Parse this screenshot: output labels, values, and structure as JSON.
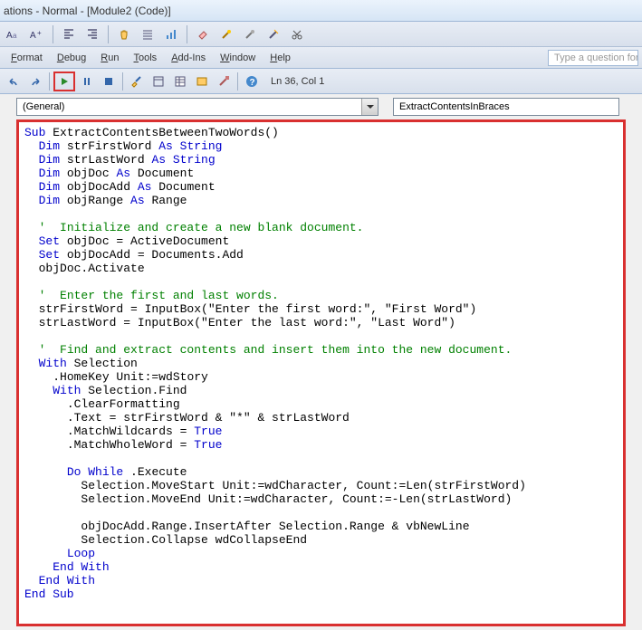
{
  "title": "ations - Normal - [Module2 (Code)]",
  "toolbar1_icons": [
    "aa-icon",
    "aplus-icon",
    "indent-left-icon",
    "indent-right-icon",
    "hand-icon",
    "lines-icon",
    "chart-icon",
    "eraser-icon",
    "wand-icon",
    "wand2-icon",
    "wand3-icon",
    "scissors-icon"
  ],
  "menu": {
    "format": "Format",
    "debug": "Debug",
    "run": "Run",
    "tools": "Tools",
    "addins": "Add-Ins",
    "window": "Window",
    "help": "Help"
  },
  "help_placeholder": "Type a question for h",
  "cursor_pos": "Ln 36, Col 1",
  "dropdown_left": "(General)",
  "dropdown_right": "ExtractContentsInBraces",
  "code": {
    "l1_a": "Sub",
    "l1_b": " ExtractContentsBetweenTwoWords()",
    "l2_a": "Dim",
    "l2_b": " strFirstWord ",
    "l2_c": "As String",
    "l3_a": "Dim",
    "l3_b": " strLastWord ",
    "l3_c": "As String",
    "l4_a": "Dim",
    "l4_b": " objDoc ",
    "l4_c": "As",
    "l4_d": " Document",
    "l5_a": "Dim",
    "l5_b": " objDocAdd ",
    "l5_c": "As",
    "l5_d": " Document",
    "l6_a": "Dim",
    "l6_b": " objRange ",
    "l6_c": "As",
    "l6_d": " Range",
    "l8": "'  Initialize and create a new blank document.",
    "l9_a": "Set",
    "l9_b": " objDoc = ActiveDocument",
    "l10_a": "Set",
    "l10_b": " objDocAdd = Documents.Add",
    "l11": "objDoc.Activate",
    "l13": "'  Enter the first and last words.",
    "l14": "strFirstWord = InputBox(\"Enter the first word:\", \"First Word\")",
    "l15": "strLastWord = InputBox(\"Enter the last word:\", \"Last Word\")",
    "l17": "'  Find and extract contents and insert them into the new document.",
    "l18_a": "With",
    "l18_b": " Selection",
    "l19": ".HomeKey Unit:=wdStory",
    "l20_a": "With",
    "l20_b": " Selection.Find",
    "l21": ".ClearFormatting",
    "l22": ".Text = strFirstWord & \"*\" & strLastWord",
    "l23_a": ".MatchWildcards = ",
    "l23_b": "True",
    "l24_a": ".MatchWholeWord = ",
    "l24_b": "True",
    "l26_a": "Do While",
    "l26_b": " .Execute",
    "l27": "Selection.MoveStart Unit:=wdCharacter, Count:=Len(strFirstWord)",
    "l28": "Selection.MoveEnd Unit:=wdCharacter, Count:=-Len(strLastWord)",
    "l30": "objDocAdd.Range.InsertAfter Selection.Range & vbNewLine",
    "l31": "Selection.Collapse wdCollapseEnd",
    "l32": "Loop",
    "l33": "End With",
    "l34": "End With",
    "l35": "End Sub"
  }
}
